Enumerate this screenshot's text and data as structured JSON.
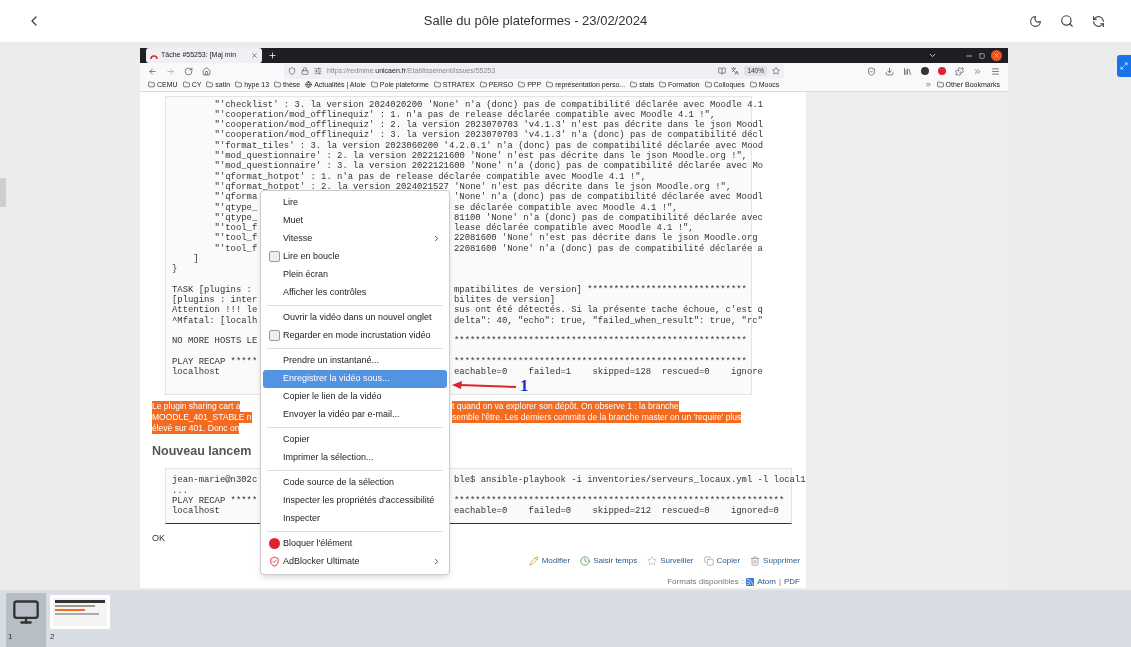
{
  "viewer": {
    "title": "Salle du pôle plateformes - 23/02/2024"
  },
  "browser": {
    "tab": {
      "title": "Tâche #55253: [Maj min"
    },
    "url_host": "https://redmine.",
    "url_domain": "unicaen.fr",
    "url_path": "/Etablissement/issues/55253",
    "zoom": "140%",
    "bookmarks": [
      {
        "label": "CEMU",
        "kind": "folder"
      },
      {
        "label": "CY",
        "kind": "folder"
      },
      {
        "label": "satin",
        "kind": "folder"
      },
      {
        "label": "hype 13",
        "kind": "folder"
      },
      {
        "label": "thèse",
        "kind": "folder"
      },
      {
        "label": "Actualités | Atole",
        "kind": "site"
      },
      {
        "label": "Pole plateforme",
        "kind": "folder"
      },
      {
        "label": "STRATEX",
        "kind": "folder"
      },
      {
        "label": "PERSO",
        "kind": "folder"
      },
      {
        "label": "PPP",
        "kind": "folder"
      },
      {
        "label": "représentation perso...",
        "kind": "folder"
      },
      {
        "label": "stats",
        "kind": "folder"
      },
      {
        "label": "Formation",
        "kind": "folder"
      },
      {
        "label": "Colloques",
        "kind": "folder"
      },
      {
        "label": "Moocs",
        "kind": "folder"
      }
    ],
    "other_bookmarks": "Other Bookmarks"
  },
  "page": {
    "log_lines": [
      {
        "text": "        \"'checklist' : 3. la version 2024020200 'None' n'a (donc) pas de compatibilité déclarée avec Moodle 4.1"
      },
      {
        "text": "        \"'cooperation/mod_offlinequiz' : 1. n'a pas de release déclarée compatible avec Moodle 4.1 !\","
      },
      {
        "text": "        \"'cooperation/mod_offlinequiz' : 2. la version 2023070703 'v4.1.3' n'est pas décrite dans le json Moodl"
      },
      {
        "text": "        \"'cooperation/mod_offlinequiz' : 3. la version 2023070703 'v4.1.3' n'a (donc) pas de compatibilité décl"
      },
      {
        "text": "        \"'format_tiles' : 3. la version 2023060200 '4.2.0.1' n'a (donc) pas de compatibilité déclarée avec Mood"
      },
      {
        "text": "        \"'mod_questionnaire' : 2. la version 2022121600 'None' n'est pas décrite dans le json Moodle.org !\","
      },
      {
        "text": "        \"'mod_questionnaire' : 3. la version 2022121600 'None' n'a (donc) pas de compatibilité déclarée avec Mo"
      },
      {
        "text": "        \"'qformat_hotpot' : 1. n'a pas de release déclarée compatible avec Moodle 4.1 !\","
      },
      {
        "text": "        \"'qformat_hotpot' : 2. la version 2024021527 'None' n'est pas décrite dans le json Moodle.org !\","
      },
      {
        "left": "        \"'qforma",
        "right": "'None' n'a (donc) pas de compatibilité déclarée avec Moodl"
      },
      {
        "left": "        \"'qtype_",
        "right": "se déclarée compatible avec Moodle 4.1 !\","
      },
      {
        "left": "        \"'qtype_",
        "right": "81100 'None' n'a (donc) pas de compatibilité déclarée avec"
      },
      {
        "left": "        \"'tool_f",
        "right": "lease déclarée compatible avec Moodle 4.1 !\","
      },
      {
        "left": "        \"'tool_f",
        "right": "22081600 'None' n'est pas décrite dans le json Moodle.org"
      },
      {
        "left": "        \"'tool_f",
        "right": "22081600 'None' n'a (donc) pas de compatibilité déclarée a"
      },
      {
        "text": "    ]"
      },
      {
        "text": "}"
      },
      {
        "spaced": true,
        "left": "TASK [plugins :",
        "right": "mpatibilites de version] ******************************"
      },
      {
        "left": "[plugins : inter",
        "right": "bilites de version]"
      },
      {
        "left": "Attention !!! le",
        "right": "sus ont été détectés. Si la présente tache échoue, c'est q"
      },
      {
        "left": "^Mfatal: [localh",
        "right": "delta\": 40, \"echo\": true, \"failed_when_result\": true, \"rc\""
      },
      {
        "spaced": true,
        "left": "NO MORE HOSTS LE",
        "right": "*******************************************************"
      },
      {
        "spaced": true,
        "left": "PLAY RECAP *****",
        "right": "*******************************************************"
      },
      {
        "left": "localhost",
        "right": "eachable=0    failed=1    skipped=128  rescued=0    ignore"
      }
    ],
    "highlighted_lines": [
      {
        "left": "Le plugin sharing cart a",
        "right": "t quand on va explorer son dépôt. On observe 1 : la branche"
      },
      {
        "left": "MOODLE_401_STABLE n",
        "right": "semble l'être. Les derniers commits de la branche master on un 'require' plus"
      },
      {
        "left": "élevé sur 401. Donc on"
      }
    ],
    "heading": "Nouveau lancem",
    "command_lines": [
      {
        "left": "jean-marie@n302c",
        "right": "ble$ ansible-playbook -i inventories/serveurs_locaux.yml -l local1"
      },
      {
        "text": "..."
      },
      {
        "left": "PLAY RECAP *****",
        "right": "**************************************************************"
      },
      {
        "left": "localhost",
        "right": "eachable=0    failed=0    skipped=212  rescued=0    ignored=0"
      }
    ],
    "result": "OK",
    "actions": [
      {
        "label": "Modifier",
        "kind": "edit"
      },
      {
        "label": "Saisir temps",
        "kind": "time"
      },
      {
        "label": "Surveiller",
        "kind": "watch"
      },
      {
        "label": "Copier",
        "kind": "copy"
      },
      {
        "label": "Supprimer",
        "kind": "delete"
      }
    ],
    "formats_label": "Formats disponibles :",
    "formats": [
      "Atom",
      "PDF"
    ],
    "formats_separator": "|"
  },
  "context_menu": {
    "items": [
      {
        "label": "Lire",
        "kind": "action",
        "selected": false
      },
      {
        "label": "Muet",
        "kind": "action",
        "selected": false
      },
      {
        "label": "Vitesse",
        "kind": "submenu",
        "selected": false
      },
      {
        "label": "Lire en boucle",
        "kind": "check",
        "checked": false,
        "selected": false
      },
      {
        "label": "Plein écran",
        "kind": "action",
        "selected": false
      },
      {
        "label": "Afficher les contrôles",
        "kind": "action",
        "selected": false
      },
      {
        "kind": "separator"
      },
      {
        "label": "Ouvrir la vidéo dans un nouvel onglet",
        "kind": "action",
        "selected": false
      },
      {
        "label": "Regarder en mode incrustation vidéo",
        "kind": "check",
        "checked": false,
        "selected": false
      },
      {
        "kind": "separator"
      },
      {
        "label": "Prendre un instantané...",
        "kind": "action",
        "selected": false
      },
      {
        "label": "Enregistrer la vidéo sous...",
        "kind": "action",
        "selected": true
      },
      {
        "label": "Copier le lien de la vidéo",
        "kind": "action",
        "selected": false
      },
      {
        "label": "Envoyer la vidéo par e-mail...",
        "kind": "action",
        "selected": false
      },
      {
        "kind": "separator"
      },
      {
        "label": "Copier",
        "kind": "action",
        "selected": false
      },
      {
        "label": "Imprimer la sélection...",
        "kind": "action",
        "selected": false
      },
      {
        "kind": "separator"
      },
      {
        "label": "Code source de la sélection",
        "kind": "action",
        "selected": false
      },
      {
        "label": "Inspecter les propriétés d'accessibilité",
        "kind": "action",
        "selected": false
      },
      {
        "label": "Inspecter",
        "kind": "action",
        "selected": false
      },
      {
        "kind": "separator"
      },
      {
        "label": "Bloquer l'élément",
        "kind": "blocker",
        "selected": false
      },
      {
        "label": "AdBlocker Ultimate",
        "kind": "extension",
        "selected": false
      }
    ]
  },
  "annotation": {
    "label": "1"
  },
  "thumbnails": [
    {
      "label": "1",
      "kind": "screen",
      "selected": true
    },
    {
      "label": "2",
      "kind": "slide",
      "selected": false
    }
  ]
}
